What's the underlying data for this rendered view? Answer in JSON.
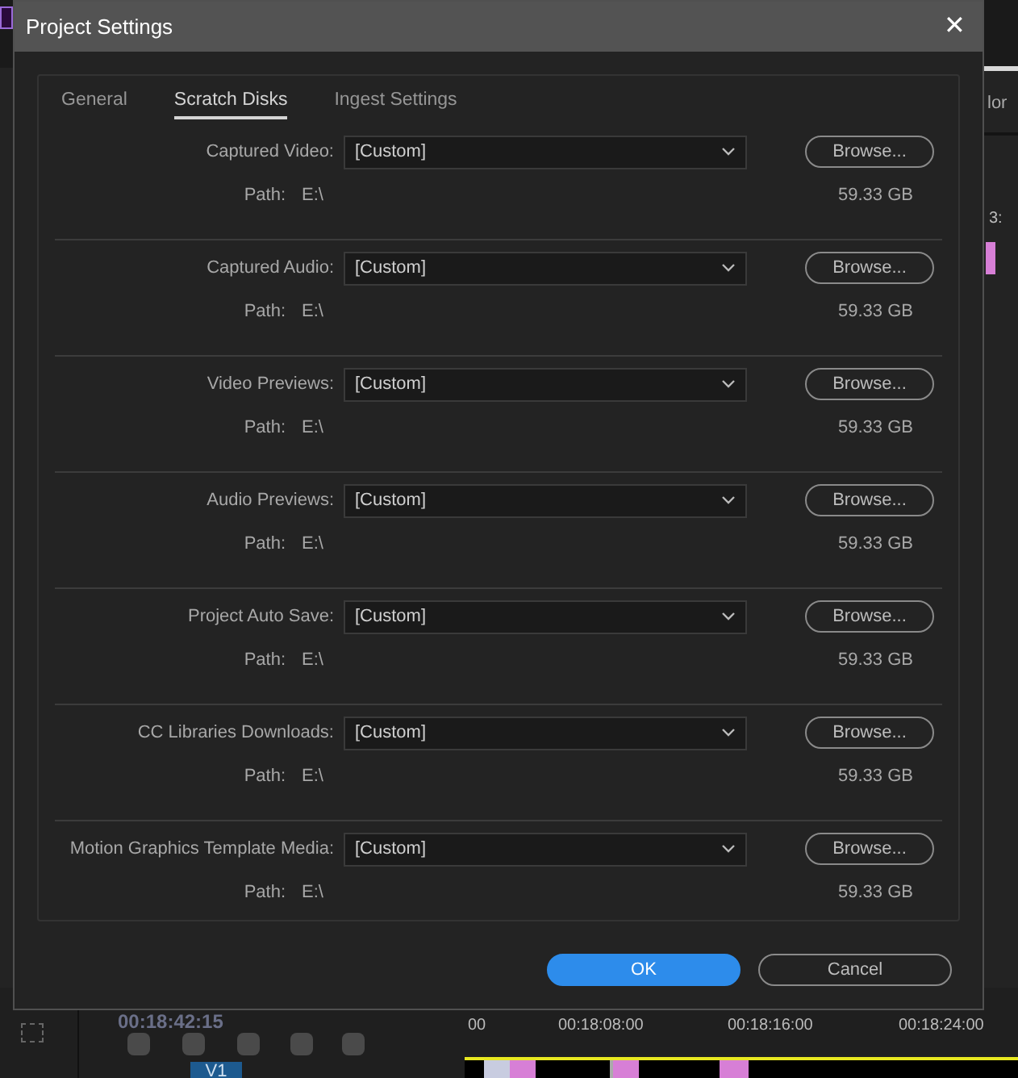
{
  "background": {
    "panel_tab": "lor",
    "marker_label": "3:",
    "timecode": "00:18:42:15",
    "ruler": [
      "00",
      "00:18:08:00",
      "00:18:16:00",
      "00:18:24:00"
    ],
    "track": "V1"
  },
  "window": {
    "title": "Project Settings",
    "close": "✕"
  },
  "tabs": [
    {
      "label": "General",
      "selected": false
    },
    {
      "label": "Scratch Disks",
      "selected": true
    },
    {
      "label": "Ingest Settings",
      "selected": false
    }
  ],
  "disks": [
    {
      "label": "Captured Video:",
      "value": "[Custom]",
      "button": "Browse...",
      "path_label": "Path:",
      "path": "E:\\",
      "size": "59.33 GB"
    },
    {
      "label": "Captured Audio:",
      "value": "[Custom]",
      "button": "Browse...",
      "path_label": "Path:",
      "path": "E:\\",
      "size": "59.33 GB"
    },
    {
      "label": "Video Previews:",
      "value": "[Custom]",
      "button": "Browse...",
      "path_label": "Path:",
      "path": "E:\\",
      "size": "59.33 GB"
    },
    {
      "label": "Audio Previews:",
      "value": "[Custom]",
      "button": "Browse...",
      "path_label": "Path:",
      "path": "E:\\",
      "size": "59.33 GB"
    },
    {
      "label": "Project Auto Save:",
      "value": "[Custom]",
      "button": "Browse...",
      "path_label": "Path:",
      "path": "E:\\",
      "size": "59.33 GB"
    },
    {
      "label": "CC Libraries Downloads:",
      "value": "[Custom]",
      "button": "Browse...",
      "path_label": "Path:",
      "path": "E:\\",
      "size": "59.33 GB"
    },
    {
      "label": "Motion Graphics Template Media:",
      "value": "[Custom]",
      "button": "Browse...",
      "path_label": "Path:",
      "path": "E:\\",
      "size": "59.33 GB"
    }
  ],
  "buttons": [
    {
      "label": "OK",
      "kind": "primary"
    },
    {
      "label": "Cancel",
      "kind": "secondary"
    }
  ]
}
